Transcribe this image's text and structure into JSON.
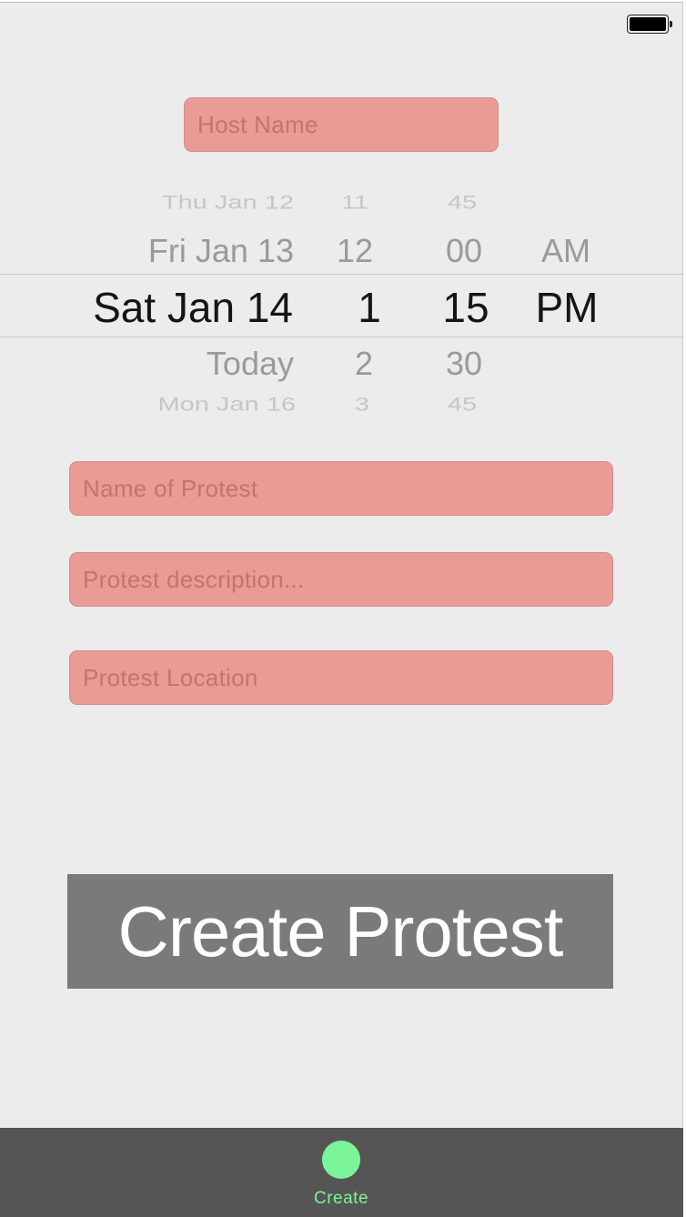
{
  "status_bar": {
    "battery_icon": "battery-full-icon"
  },
  "form": {
    "host_name": {
      "placeholder": "Host Name",
      "value": ""
    },
    "protest_name": {
      "placeholder": "Name of Protest",
      "value": ""
    },
    "protest_description": {
      "placeholder": "Protest description...",
      "value": ""
    },
    "protest_location": {
      "placeholder": "Protest Location",
      "value": ""
    }
  },
  "date_picker": {
    "dates": [
      "Thu Jan 12",
      "Fri Jan 13",
      "Sat Jan 14",
      "Today",
      "Mon Jan 16"
    ],
    "hours": [
      "11",
      "12",
      "1",
      "2",
      "3"
    ],
    "minutes": [
      "45",
      "00",
      "15",
      "30",
      "45"
    ],
    "periods": [
      "AM",
      "PM"
    ],
    "selected": {
      "date": "Sat Jan 14",
      "hour": "1",
      "minute": "15",
      "period": "PM"
    }
  },
  "actions": {
    "create_label": "Create Protest"
  },
  "tab_bar": {
    "items": [
      {
        "label": "Create",
        "icon": "circle-icon",
        "color": "#7cf59a",
        "active": true
      }
    ]
  },
  "colors": {
    "field_bg": "#eb9b96",
    "button_bg": "#7a7a7a",
    "tabbar_bg": "#555555",
    "accent": "#7cf59a"
  }
}
